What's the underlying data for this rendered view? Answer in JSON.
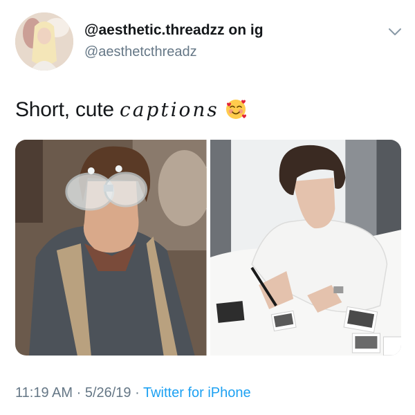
{
  "tweet": {
    "display_name": "@aesthetic.threadzz on ig",
    "handle": "@aesthetcthreadz",
    "text_prefix": "Short, cute ",
    "text_cursive": "captions",
    "emoji_icon": "smiling-face-with-hearts-icon",
    "media": [
      {
        "alt": "young man wearing safety goggles and apron"
      },
      {
        "alt": "young man writing on polaroid photos on a bed"
      }
    ],
    "time": "11:19 AM",
    "separator": "·",
    "date": "5/26/19",
    "source": "Twitter for iPhone"
  },
  "colors": {
    "text": "#14171a",
    "secondary": "#657786",
    "link": "#1da1f2",
    "background": "#ffffff"
  }
}
